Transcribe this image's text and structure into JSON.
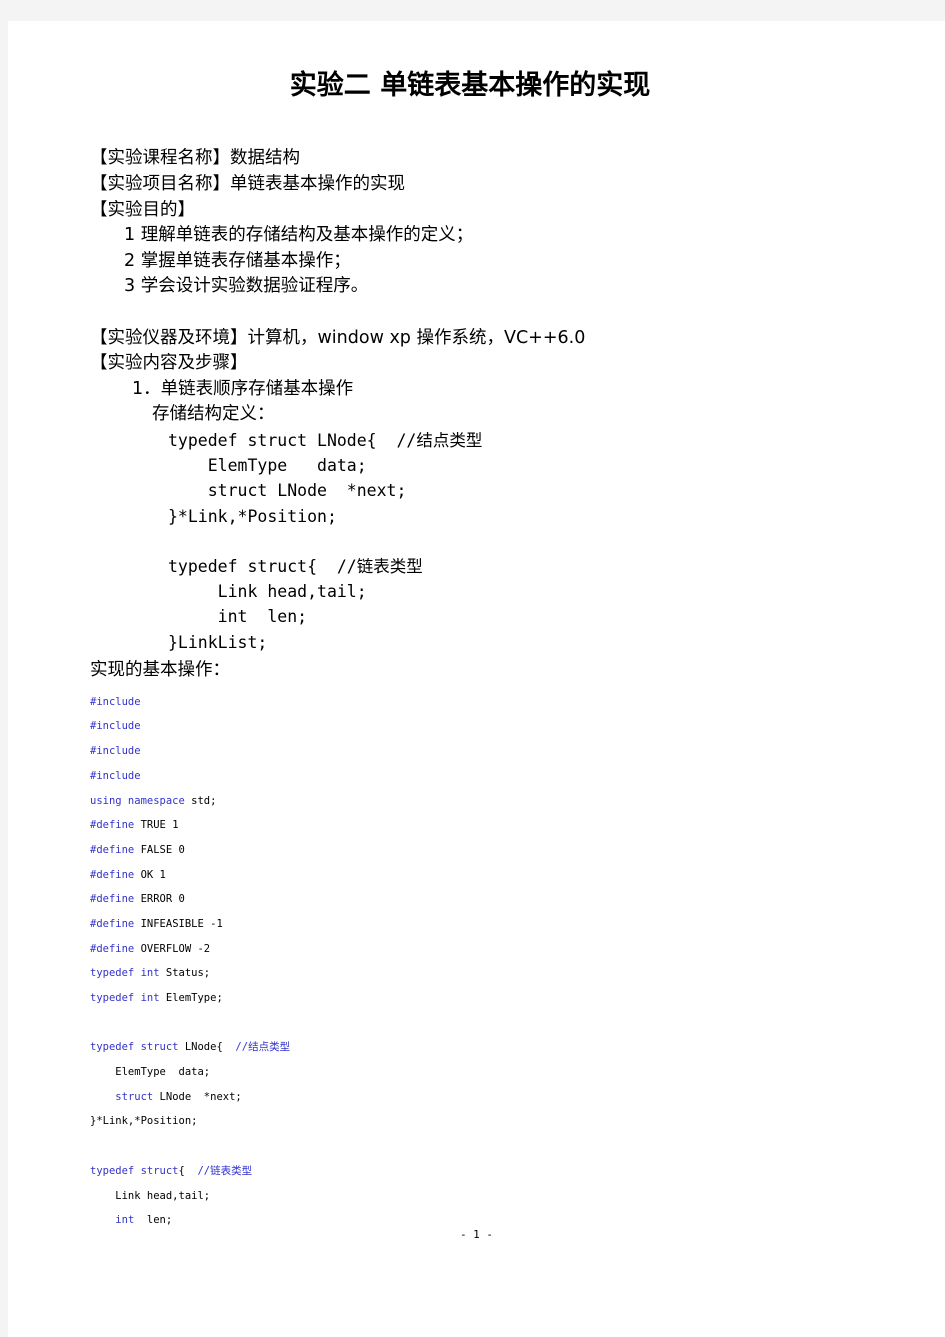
{
  "document": {
    "title": "实验二  单链表基本操作的实现",
    "footer": "- 1 -"
  },
  "header_fields": {
    "course_name": "【实验课程名称】数据结构",
    "project_name": "【实验项目名称】单链表基本操作的实现",
    "purpose_label": "【实验目的】",
    "purpose_items": [
      "1 理解单链表的存储结构及基本操作的定义；",
      "2 掌握单链表存储基本操作；",
      "3 学会设计实验数据验证程序。"
    ],
    "environment": "【实验仪器及环境】计算机，window xp 操作系统，VC++6.0",
    "content_label": "【实验内容及步骤】",
    "step_1": "1．单链表顺序存储基本操作",
    "struct_def_label": "存储结构定义："
  },
  "body_code": [
    "typedef struct LNode{  //结点类型",
    "    ElemType   data;",
    "    struct LNode  *next;",
    "}*Link,*Position;",
    "",
    "typedef struct{  //链表类型",
    "     Link head,tail;",
    "     int  len;",
    "}LinkList;"
  ],
  "impl_label": "实现的基本操作：",
  "source_listing": [
    {
      "parts": [
        {
          "t": "#include",
          "c": "kw"
        }
      ]
    },
    {
      "parts": [
        {
          "t": "#include",
          "c": "kw"
        }
      ]
    },
    {
      "parts": [
        {
          "t": "#include",
          "c": "kw"
        }
      ]
    },
    {
      "parts": [
        {
          "t": "#include",
          "c": "kw"
        }
      ]
    },
    {
      "parts": [
        {
          "t": "using namespace",
          "c": "kw"
        },
        {
          "t": " std;",
          "c": "id"
        }
      ]
    },
    {
      "parts": [
        {
          "t": "#define",
          "c": "kw"
        },
        {
          "t": " TRUE 1",
          "c": "id"
        }
      ]
    },
    {
      "parts": [
        {
          "t": "#define",
          "c": "kw"
        },
        {
          "t": " FALSE 0",
          "c": "id"
        }
      ]
    },
    {
      "parts": [
        {
          "t": "#define",
          "c": "kw"
        },
        {
          "t": " OK 1",
          "c": "id"
        }
      ]
    },
    {
      "parts": [
        {
          "t": "#define",
          "c": "kw"
        },
        {
          "t": " ERROR 0",
          "c": "id"
        }
      ]
    },
    {
      "parts": [
        {
          "t": "#define",
          "c": "kw"
        },
        {
          "t": " INFEASIBLE -1",
          "c": "id"
        }
      ]
    },
    {
      "parts": [
        {
          "t": "#define",
          "c": "kw"
        },
        {
          "t": " OVERFLOW -2",
          "c": "id"
        }
      ]
    },
    {
      "parts": [
        {
          "t": "typedef int",
          "c": "kw"
        },
        {
          "t": " Status;",
          "c": "id"
        }
      ]
    },
    {
      "parts": [
        {
          "t": "typedef int",
          "c": "kw"
        },
        {
          "t": " ElemType;",
          "c": "id"
        }
      ]
    },
    {
      "parts": [
        {
          "t": "",
          "c": "id"
        }
      ]
    },
    {
      "parts": [
        {
          "t": "typedef struct",
          "c": "kw"
        },
        {
          "t": " LNode{  ",
          "c": "id"
        },
        {
          "t": "//结点类型",
          "c": "cm"
        }
      ]
    },
    {
      "parts": [
        {
          "t": "    ElemType  data;",
          "c": "id"
        }
      ]
    },
    {
      "parts": [
        {
          "t": "    ",
          "c": "id"
        },
        {
          "t": "struct",
          "c": "kw"
        },
        {
          "t": " LNode  *next;",
          "c": "id"
        }
      ]
    },
    {
      "parts": [
        {
          "t": "}*Link,*Position;",
          "c": "id"
        }
      ]
    },
    {
      "parts": [
        {
          "t": "",
          "c": "id"
        }
      ]
    },
    {
      "parts": [
        {
          "t": "typedef struct",
          "c": "kw"
        },
        {
          "t": "{  ",
          "c": "id"
        },
        {
          "t": "//链表类型",
          "c": "cm"
        }
      ]
    },
    {
      "parts": [
        {
          "t": "    Link head,tail;",
          "c": "id"
        }
      ]
    },
    {
      "parts": [
        {
          "t": "    ",
          "c": "id"
        },
        {
          "t": "int",
          "c": "kw"
        },
        {
          "t": "  len;",
          "c": "id"
        }
      ]
    }
  ]
}
